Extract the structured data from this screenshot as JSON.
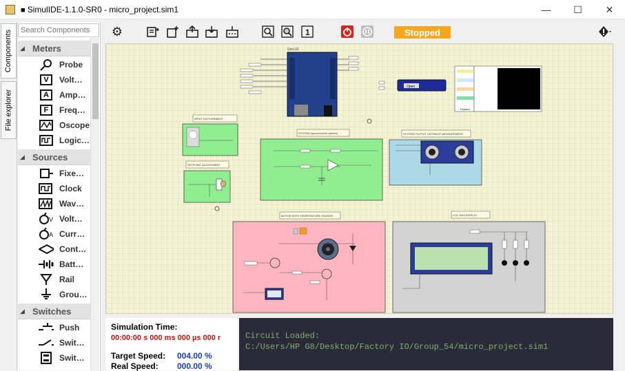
{
  "window": {
    "title": "SimulIDE-1.1.0-SR0 - micro_project.sim1",
    "minimize": "—",
    "maximize": "☐",
    "close": "✕"
  },
  "side_tabs": [
    "Components",
    "File explorer"
  ],
  "search": {
    "placeholder": "Search Components"
  },
  "categories": [
    {
      "label": "Meters",
      "items": [
        "Probe",
        "Volt…",
        "Amp…",
        "Freq…",
        "Oscope",
        "Logic…"
      ]
    },
    {
      "label": "Sources",
      "items": [
        "Fixe…",
        "Clock",
        "Wav…",
        "Volt…",
        "Curr…",
        "Cont…",
        "Batt…",
        "Rail",
        "Grou…"
      ]
    },
    {
      "label": "Switches",
      "items": [
        "Push",
        "Swit…",
        "Swit…"
      ]
    }
  ],
  "toolbar": {
    "status": "Stopped"
  },
  "canvas": {
    "board_label": "Uno-32",
    "serial_button": "Open",
    "lcd_expand": "Expand",
    "sections": [
      "INPUT DISTURBANCE",
      "SETPOINT ADJUSTMENT",
      "SYSTEM (dynamics/ctrl system)",
      "SYSTEM OUTPUT DISTANCE MEASUREMENT",
      "MOTOR WITH TEMPERATURE SENSOR",
      "LCD 16x2 DISPLAY"
    ]
  },
  "simulation": {
    "time_label": "Simulation Time:",
    "time_value": "00:00:00 s  000 ms  000 µs  000 r",
    "target_label": "Target Speed:",
    "target_value": "004.00 %",
    "real_label": "Real Speed:",
    "real_value": "000.00 %"
  },
  "console": {
    "line1": "Circuit Loaded:",
    "line2": "C:/Users/HP G8/Desktop/Factory IO/Group_54/micro_project.sim1"
  }
}
